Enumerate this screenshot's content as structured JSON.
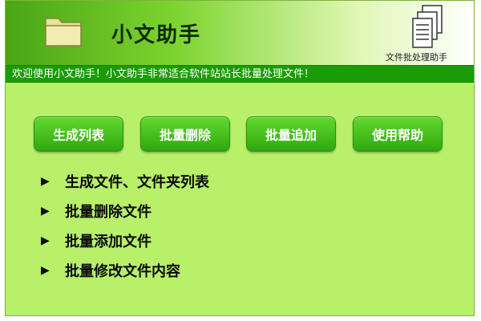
{
  "header": {
    "title": "小文助手",
    "batch_label": "文件批处理助手",
    "folder_icon": "folder-icon",
    "batch_icon": "documents-icon"
  },
  "banner": {
    "text": "欢迎使用小文助手！小文助手非常适合软件站站长批量处理文件！"
  },
  "buttons": [
    {
      "label": "生成列表"
    },
    {
      "label": "批量删除"
    },
    {
      "label": "批量追加"
    },
    {
      "label": "使用帮助"
    }
  ],
  "features": [
    {
      "text": "生成文件、文件夹列表"
    },
    {
      "text": "批量删除文件"
    },
    {
      "text": "批量添加文件"
    },
    {
      "text": "批量修改文件内容"
    }
  ],
  "colors": {
    "background": "#b8f06a",
    "banner": "#1a9c06",
    "button": "#3fbf16"
  }
}
